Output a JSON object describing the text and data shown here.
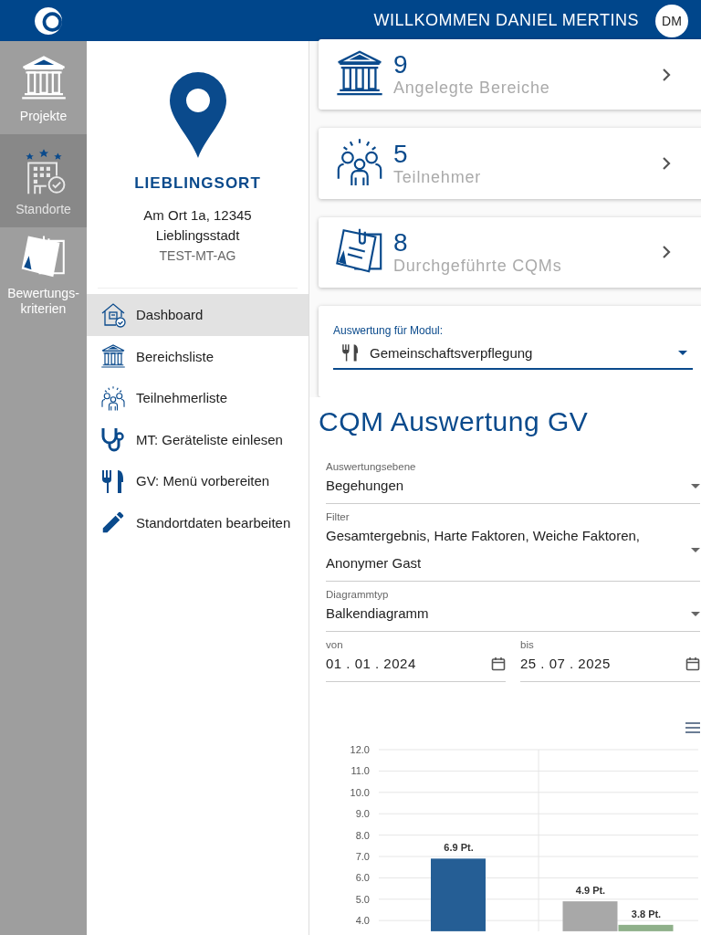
{
  "header": {
    "title": "WILLKOMMEN DANIEL MERTINS",
    "avatar": "DM"
  },
  "rail": [
    {
      "label": "Projekte",
      "selected": false
    },
    {
      "label": "Standorte",
      "selected": true
    },
    {
      "label": "Bewertungs-kriterien",
      "selected": false
    }
  ],
  "location": {
    "name": "LIEBLINGSORT",
    "address": "Am Ort 1a, 12345",
    "city": "Lieblingsstadt",
    "company": "TEST-MT-AG"
  },
  "menu": [
    {
      "label": "Dashboard",
      "selected": true
    },
    {
      "label": "Bereichsliste",
      "selected": false
    },
    {
      "label": "Teilnehmerliste",
      "selected": false
    },
    {
      "label": "MT: Geräteliste einlesen",
      "selected": false
    },
    {
      "label": "GV: Menü vorbereiten",
      "selected": false
    },
    {
      "label": "Standortdaten bearbeiten",
      "selected": false
    }
  ],
  "stats": [
    {
      "value": "9",
      "label": "Angelegte Bereiche"
    },
    {
      "value": "5",
      "label": "Teilnehmer"
    },
    {
      "value": "8",
      "label": "Durchgeführte CQMs"
    }
  ],
  "module": {
    "label": "Auswertung für Modul:",
    "value": "Gemeinschaftsverpflegung"
  },
  "evaluation": {
    "title": "CQM Auswertung GV",
    "fields": [
      {
        "kind": "select",
        "label": "Auswertungsebene",
        "value": "Begehungen"
      },
      {
        "kind": "select",
        "label": "Filter",
        "value": "Gesamtergebnis, Harte Faktoren, Weiche Faktoren, Anonymer Gast"
      },
      {
        "kind": "select",
        "label": "Diagrammtyp",
        "value": "Balkendiagramm"
      }
    ],
    "dates": [
      {
        "label": "von",
        "value": "01 . 01 . 2024"
      },
      {
        "label": "bis",
        "value": "25 . 07 . 2025"
      }
    ],
    "chart_data": {
      "type": "bar",
      "grid": true,
      "ylim": [
        3.5,
        12
      ],
      "yticks": [
        {
          "value": 4,
          "label": "4.0"
        },
        {
          "value": 5,
          "label": "5.0"
        },
        {
          "value": 6,
          "label": "6.0"
        },
        {
          "value": 7,
          "label": "7.0"
        },
        {
          "value": 8,
          "label": "8.0"
        },
        {
          "value": 9,
          "label": "9.0"
        },
        {
          "value": 10,
          "label": "10.0"
        },
        {
          "value": 11,
          "label": "11.0"
        },
        {
          "value": 12,
          "label": "12.0"
        }
      ],
      "series": [
        {
          "color": "#255e95",
          "values": [
            6.9,
            null
          ]
        },
        {
          "color": "#a8a8a8",
          "values": [
            null,
            4.9
          ]
        },
        {
          "color": "#8fb08a",
          "values": [
            null,
            3.8
          ]
        }
      ],
      "value_labels": [
        [
          "6.9 Pt.",
          null
        ],
        [
          null,
          "4.9 Pt."
        ],
        [
          null,
          "3.8 Pt."
        ]
      ]
    }
  }
}
